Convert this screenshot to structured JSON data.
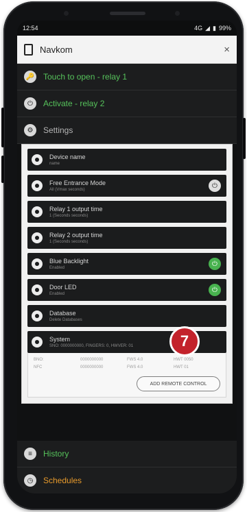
{
  "status_bar": {
    "time": "12:54",
    "network": "4G",
    "battery": "99%"
  },
  "titlebar": {
    "title": "Navkom",
    "close_glyph": "×"
  },
  "menu": {
    "touch_open": "Touch to open - relay 1",
    "activate": "Activate - relay 2",
    "settings": "Settings",
    "history": "History",
    "schedules": "Schedules"
  },
  "settings": {
    "items": [
      {
        "label": "Device name",
        "sub": "name"
      },
      {
        "label": "Free Entrance Mode",
        "sub": "All (Vmax seconds)",
        "toggle": "off"
      },
      {
        "label": "Relay 1 output time",
        "sub": "1 (Seconds seconds)"
      },
      {
        "label": "Relay 2 output time",
        "sub": "1 (Seconds seconds)"
      },
      {
        "label": "Blue Backlight",
        "sub": "Enabled",
        "toggle": "on"
      },
      {
        "label": "Door LED",
        "sub": "Enabled",
        "toggle": "on"
      },
      {
        "label": "Database",
        "sub": "Delete Databases"
      },
      {
        "label": "System",
        "sub": "SNO: 0000000000, FINGERS: 0, HWVER: 01"
      }
    ]
  },
  "system_info": {
    "row1": [
      "BNO:",
      "0000000000",
      "FWS 4.0",
      "HWT 0050"
    ],
    "row2": [
      "NFC",
      "0000000000",
      "FWS 4.0",
      "HWT 01"
    ]
  },
  "add_remote": "ADD REMOTE CONTROL",
  "badge": "7",
  "colors": {
    "accent_green": "#56c25b",
    "badge_red": "#c3222b",
    "schedules_orange": "#e79a2c"
  },
  "icons": [
    "lock-icon",
    "power-icon",
    "gear-icon",
    "history-icon",
    "schedule-icon",
    "device-icon",
    "close-icon"
  ]
}
